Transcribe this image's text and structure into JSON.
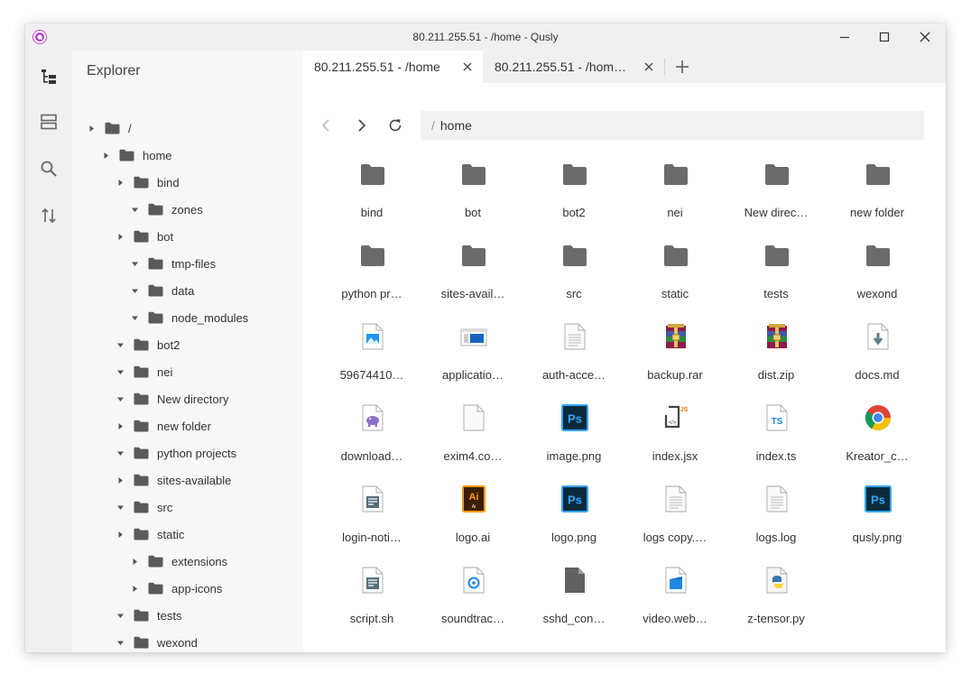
{
  "window": {
    "title": "80.211.255.51 - /home - Qusly"
  },
  "activity_bar": {
    "items": [
      {
        "icon": "tree-icon",
        "name": "explorer"
      },
      {
        "icon": "sites-icon",
        "name": "sites"
      },
      {
        "icon": "search-icon",
        "name": "search"
      },
      {
        "icon": "transfers-icon",
        "name": "transfers"
      }
    ]
  },
  "explorer": {
    "title": "Explorer",
    "tree": [
      {
        "label": "/",
        "depth": 0,
        "caret": "right"
      },
      {
        "label": "home",
        "depth": 1,
        "caret": "right"
      },
      {
        "label": "bind",
        "depth": 2,
        "caret": "right"
      },
      {
        "label": "zones",
        "depth": 3,
        "caret": "down"
      },
      {
        "label": "bot",
        "depth": 2,
        "caret": "right"
      },
      {
        "label": "tmp-files",
        "depth": 3,
        "caret": "down"
      },
      {
        "label": "data",
        "depth": 3,
        "caret": "down"
      },
      {
        "label": "node_modules",
        "depth": 3,
        "caret": "down"
      },
      {
        "label": "bot2",
        "depth": 2,
        "caret": "down"
      },
      {
        "label": "nei",
        "depth": 2,
        "caret": "down"
      },
      {
        "label": "New directory",
        "depth": 2,
        "caret": "down"
      },
      {
        "label": "new folder",
        "depth": 2,
        "caret": "right"
      },
      {
        "label": "python projects",
        "depth": 2,
        "caret": "down"
      },
      {
        "label": "sites-available",
        "depth": 2,
        "caret": "right"
      },
      {
        "label": "src",
        "depth": 2,
        "caret": "down"
      },
      {
        "label": "static",
        "depth": 2,
        "caret": "right"
      },
      {
        "label": "extensions",
        "depth": 3,
        "caret": "right"
      },
      {
        "label": "app-icons",
        "depth": 3,
        "caret": "right"
      },
      {
        "label": "tests",
        "depth": 2,
        "caret": "down"
      },
      {
        "label": "wexond",
        "depth": 2,
        "caret": "down"
      }
    ]
  },
  "tabs": [
    {
      "label": "80.211.255.51 - /home",
      "active": true
    },
    {
      "label": "80.211.255.51 - /hom…",
      "active": false
    }
  ],
  "path": {
    "separator": "/",
    "segments": [
      "home"
    ]
  },
  "files": [
    {
      "name": "bind",
      "icon": "folder"
    },
    {
      "name": "bot",
      "icon": "folder"
    },
    {
      "name": "bot2",
      "icon": "folder"
    },
    {
      "name": "nei",
      "icon": "folder"
    },
    {
      "name": "New direc…",
      "icon": "folder"
    },
    {
      "name": "new folder",
      "icon": "folder"
    },
    {
      "name": "python pr…",
      "icon": "folder"
    },
    {
      "name": "sites-avail…",
      "icon": "folder"
    },
    {
      "name": "src",
      "icon": "folder"
    },
    {
      "name": "static",
      "icon": "folder"
    },
    {
      "name": "tests",
      "icon": "folder"
    },
    {
      "name": "wexond",
      "icon": "folder"
    },
    {
      "name": "59674410…",
      "icon": "image-file"
    },
    {
      "name": "applicatio…",
      "icon": "application-file"
    },
    {
      "name": "auth-acce…",
      "icon": "text-file"
    },
    {
      "name": "backup.rar",
      "icon": "archive"
    },
    {
      "name": "dist.zip",
      "icon": "archive"
    },
    {
      "name": "docs.md",
      "icon": "markdown-file"
    },
    {
      "name": "download…",
      "icon": "php-file"
    },
    {
      "name": "exim4.co…",
      "icon": "blank-file"
    },
    {
      "name": "image.png",
      "icon": "photoshop"
    },
    {
      "name": "index.jsx",
      "icon": "jsx-file"
    },
    {
      "name": "index.ts",
      "icon": "ts-file"
    },
    {
      "name": "Kreator_c…",
      "icon": "chrome"
    },
    {
      "name": "login-noti…",
      "icon": "script-file"
    },
    {
      "name": "logo.ai",
      "icon": "illustrator"
    },
    {
      "name": "logo.png",
      "icon": "photoshop"
    },
    {
      "name": "logs copy.…",
      "icon": "text-file"
    },
    {
      "name": "logs.log",
      "icon": "text-file"
    },
    {
      "name": "qusly.png",
      "icon": "photoshop"
    },
    {
      "name": "script.sh",
      "icon": "script-file"
    },
    {
      "name": "soundtrac…",
      "icon": "audio-file"
    },
    {
      "name": "sshd_con…",
      "icon": "dark-file"
    },
    {
      "name": "video.web…",
      "icon": "video-file"
    },
    {
      "name": "z-tensor.py",
      "icon": "python-file"
    }
  ]
}
